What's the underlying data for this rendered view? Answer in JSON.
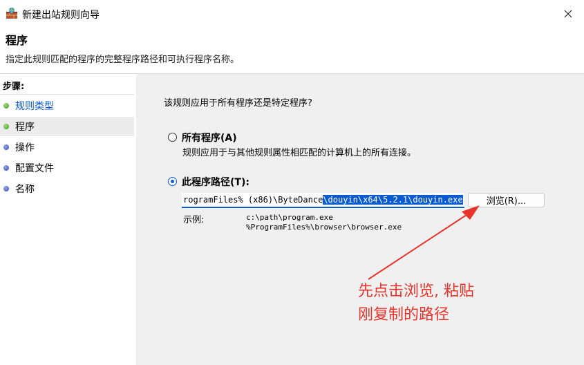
{
  "window": {
    "title": "新建出站规则向导",
    "icon": "firewall-rule-icon",
    "close_icon": "close-icon"
  },
  "header": {
    "title": "程序",
    "subtitle": "指定此规则匹配的程序的完整程序路径和可执行程序名称。"
  },
  "sidebar": {
    "steps_label": "步骤:",
    "steps": [
      {
        "label": "规则类型",
        "status": "done"
      },
      {
        "label": "程序",
        "status": "current"
      },
      {
        "label": "操作",
        "status": "pending"
      },
      {
        "label": "配置文件",
        "status": "pending"
      },
      {
        "label": "名称",
        "status": "pending"
      }
    ]
  },
  "main": {
    "question": "该规则应用于所有程序还是特定程序?",
    "option_all": {
      "label": "所有程序(A)",
      "description": "规则应用于与其他规则属性相匹配的计算机上的所有连接。",
      "selected": false
    },
    "option_path": {
      "label": "此程序路径(T):",
      "selected": true
    },
    "path_value_unselected": "rogramFiles% (x86)\\ByteDance",
    "path_value_selected": "\\douyin\\x64\\5.2.1\\douyin.exe",
    "browse_label": "浏览(R)...",
    "example_label": "示例:",
    "example_lines": [
      "c:\\path\\program.exe",
      "%ProgramFiles%\\browser\\browser.exe"
    ]
  },
  "annotation": {
    "line1": "先点击浏览, 粘贴",
    "line2": "刚复制的路径",
    "color": "#e8332a"
  }
}
